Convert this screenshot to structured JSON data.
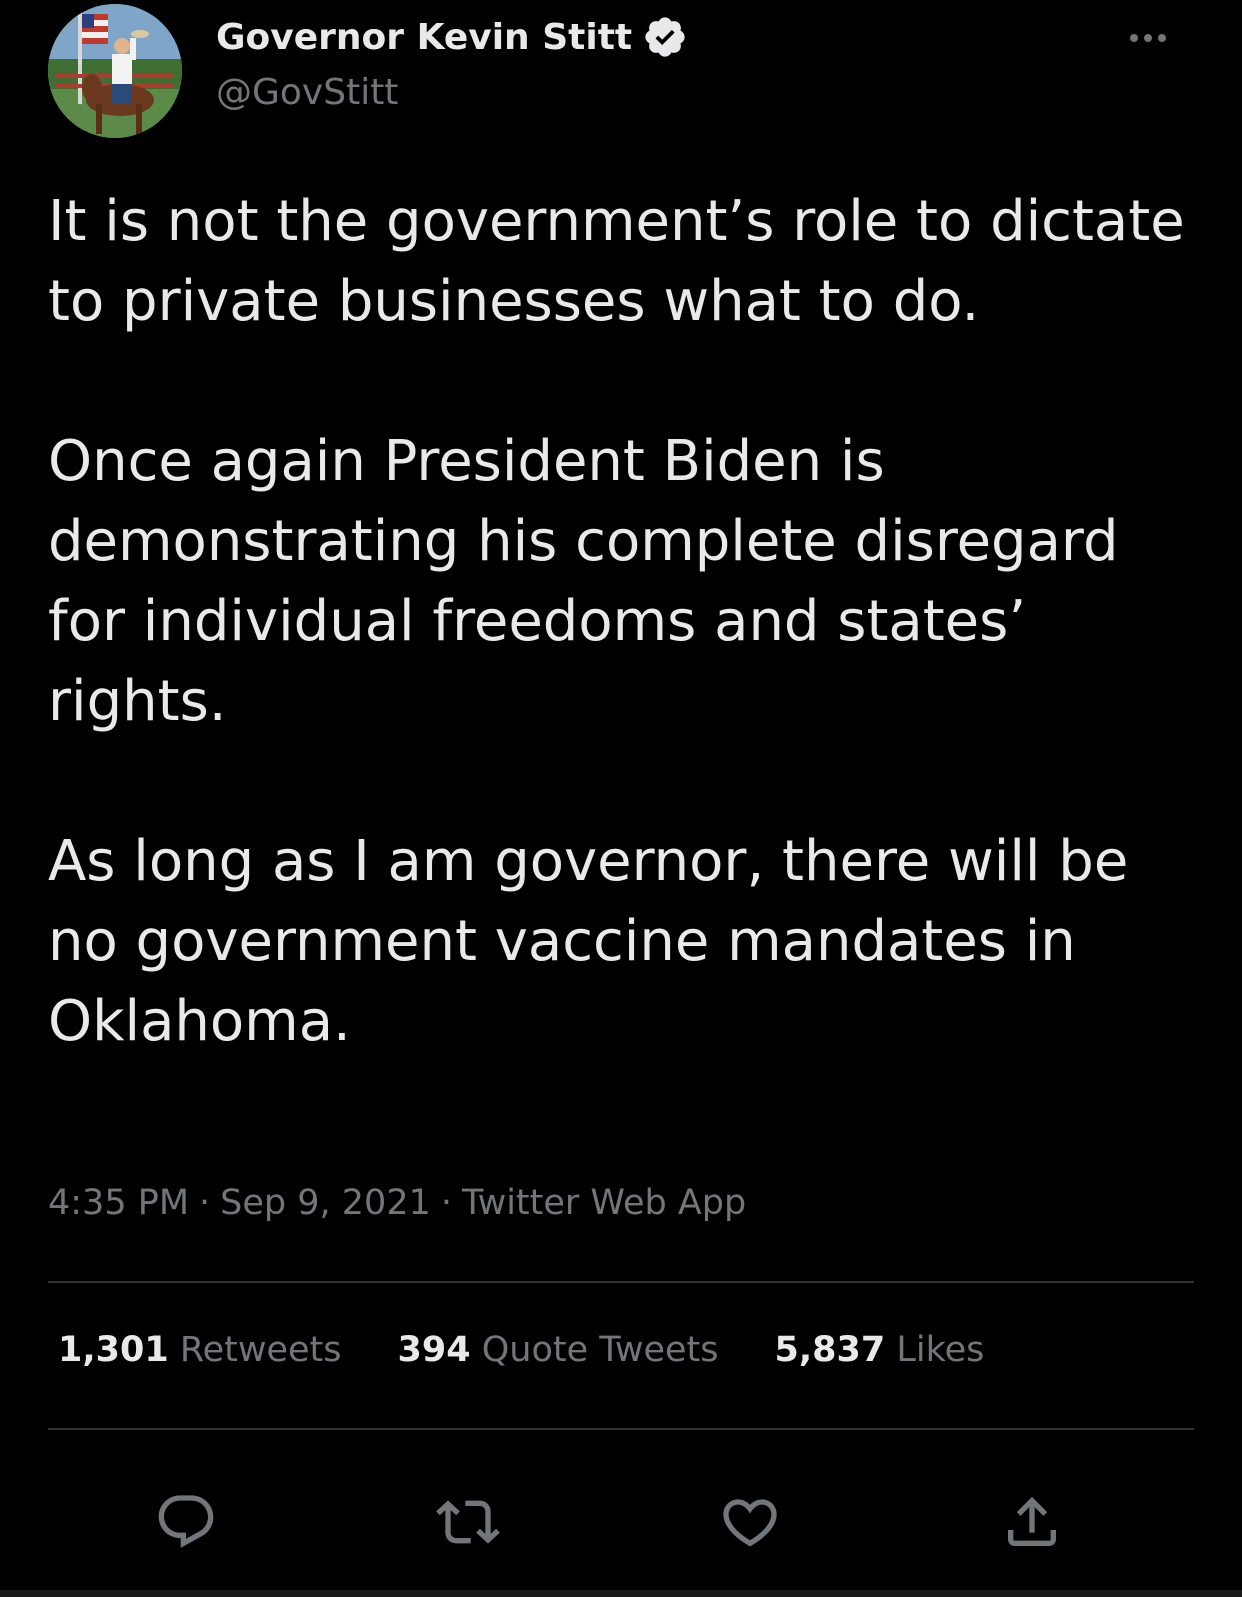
{
  "author": {
    "name": "Governor Kevin Stitt",
    "handle": "@GovStitt",
    "verified": true
  },
  "tweet": {
    "paragraphs": [
      "It is not the government’s role to dictate to private businesses what to do.",
      "Once again President Biden is demonstrating his complete disregard for individual freedoms and states’ rights.",
      "As long as I am governor, there will be no government vaccine mandates in Oklahoma."
    ],
    "time": "4:35 PM",
    "date": "Sep 9, 2021",
    "source": "Twitter Web App",
    "separator": "·"
  },
  "stats": {
    "retweets": {
      "count": "1,301",
      "label": "Retweets"
    },
    "quotes": {
      "count": "394",
      "label": "Quote Tweets"
    },
    "likes": {
      "count": "5,837",
      "label": "Likes"
    }
  },
  "icons": {
    "more": "more-horizontal-icon",
    "verified": "verified-badge-icon",
    "reply": "reply-icon",
    "retweet": "retweet-icon",
    "like": "heart-icon",
    "share": "share-icon"
  },
  "colors": {
    "background": "#000000",
    "text_primary": "#e7e9ea",
    "text_secondary": "#71767b",
    "divider": "#2f3336"
  }
}
